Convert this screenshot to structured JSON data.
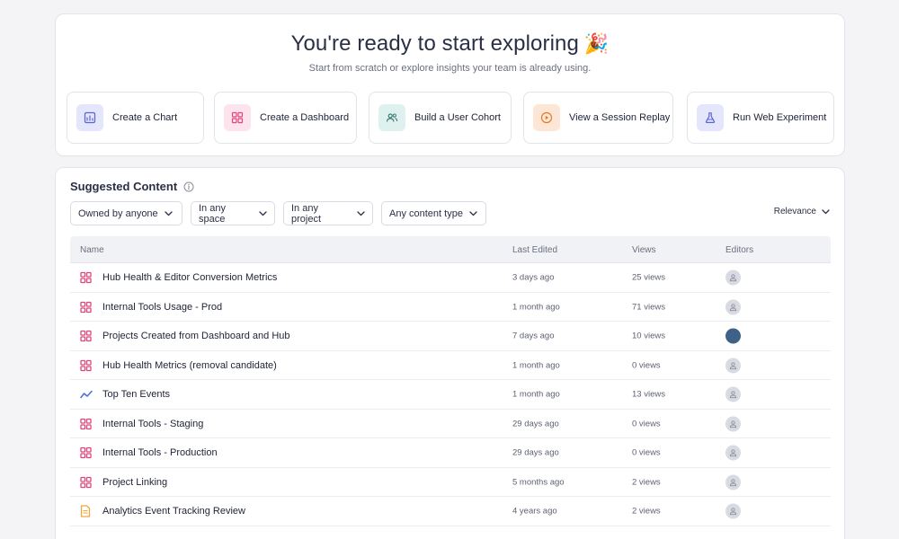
{
  "hero": {
    "title": "You're ready to start exploring",
    "title_emoji": "🎉",
    "subtitle": "Start from scratch or explore insights your team is already using."
  },
  "actions": [
    {
      "label": "Create a Chart",
      "icon": "chart-icon",
      "bg": "#e4e6fb",
      "fg": "#5b63d3"
    },
    {
      "label": "Create a Dashboard",
      "icon": "dashboard-icon",
      "bg": "#fde3ee",
      "fg": "#e0457b"
    },
    {
      "label": "Build a User Cohort",
      "icon": "users-icon",
      "bg": "#dff1ef",
      "fg": "#3f7e78"
    },
    {
      "label": "View a Session Replay",
      "icon": "play-icon",
      "bg": "#fde6d6",
      "fg": "#e37b2c"
    },
    {
      "label": "Run Web Experiment",
      "icon": "flask-icon",
      "bg": "#e4e6fb",
      "fg": "#5b63d3"
    }
  ],
  "suggested": {
    "title": "Suggested Content",
    "filters": [
      "Owned by anyone",
      "In any space",
      "In any project",
      "Any content type"
    ],
    "sort": "Relevance",
    "columns": [
      "Name",
      "Last Edited",
      "Views",
      "Editors"
    ],
    "rows": [
      {
        "icon": "dashboard-icon",
        "name": "Hub Health & Editor Conversion Metrics",
        "edited": "3 days ago",
        "views": "25 views",
        "editor": "default-avatar"
      },
      {
        "icon": "dashboard-icon",
        "name": "Internal Tools Usage - Prod",
        "edited": "1 month ago",
        "views": "71 views",
        "editor": "default-avatar"
      },
      {
        "icon": "dashboard-icon",
        "name": "Projects Created from Dashboard and Hub",
        "edited": "7 days ago",
        "views": "10 views",
        "editor": "user-avatar"
      },
      {
        "icon": "dashboard-icon",
        "name": "Hub Health Metrics (removal candidate)",
        "edited": "1 month ago",
        "views": "0 views",
        "editor": "default-avatar"
      },
      {
        "icon": "line-chart-icon",
        "name": "Top Ten Events",
        "edited": "1 month ago",
        "views": "13 views",
        "editor": "default-avatar"
      },
      {
        "icon": "dashboard-icon",
        "name": "Internal Tools - Staging",
        "edited": "29 days ago",
        "views": "0 views",
        "editor": "default-avatar"
      },
      {
        "icon": "dashboard-icon",
        "name": "Internal Tools - Production",
        "edited": "29 days ago",
        "views": "0 views",
        "editor": "default-avatar"
      },
      {
        "icon": "dashboard-icon",
        "name": "Project Linking",
        "edited": "5 months ago",
        "views": "2 views",
        "editor": "default-avatar"
      },
      {
        "icon": "document-icon",
        "name": "Analytics Event Tracking Review",
        "edited": "4 years ago",
        "views": "2 views",
        "editor": "default-avatar"
      }
    ]
  },
  "colors": {
    "dashboard": "#e0457b",
    "line_chart": "#4a6ee0",
    "document": "#f0a63b",
    "avatar_dark": "#3e6287"
  }
}
